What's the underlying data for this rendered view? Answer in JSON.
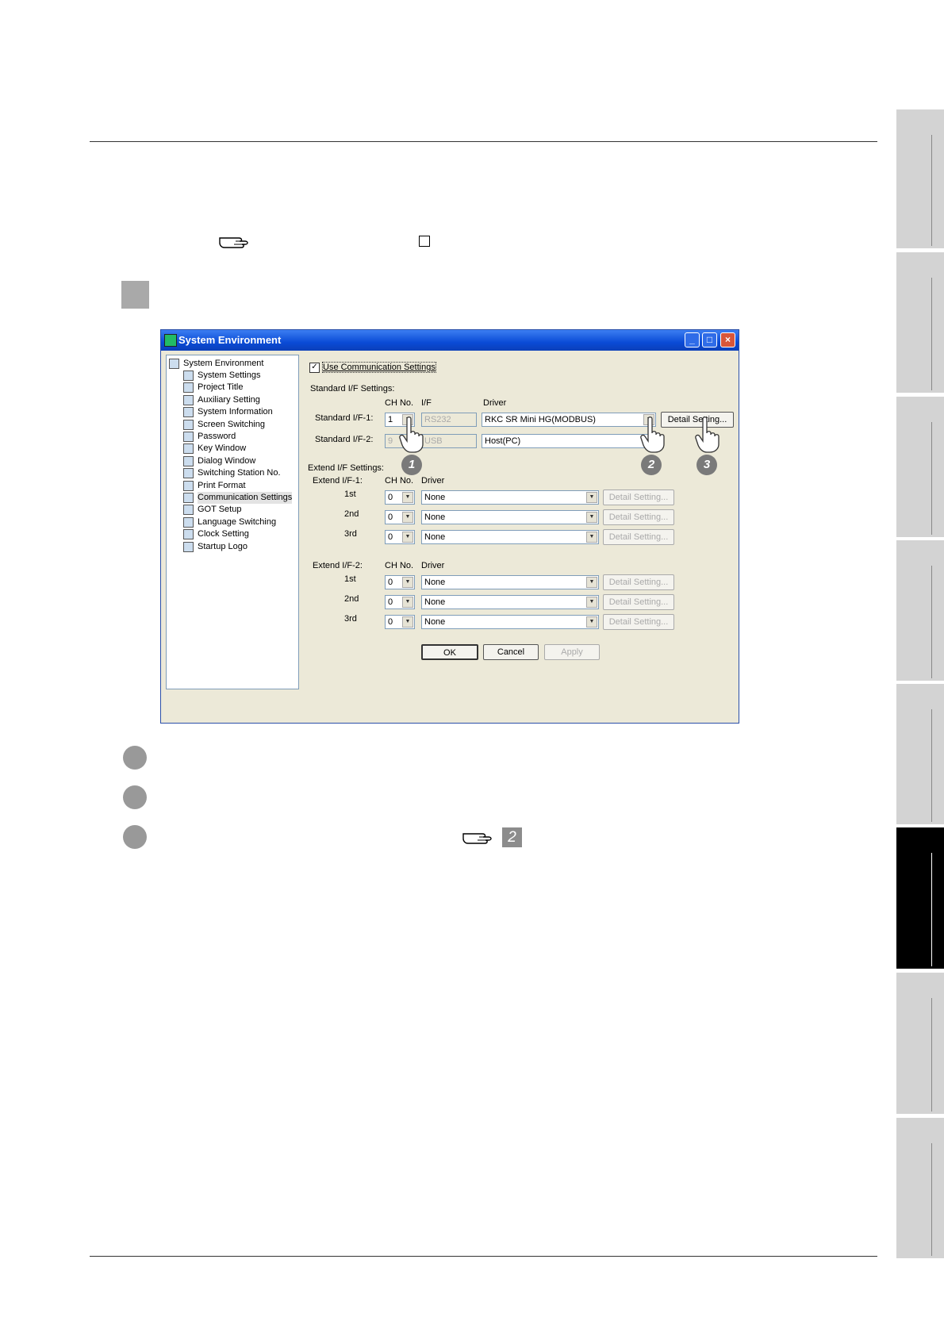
{
  "dialog": {
    "title": "System Environment",
    "title_buttons": {
      "minimize": "_",
      "maximize": "□",
      "close": "×"
    },
    "tree": [
      {
        "label": "System Environment",
        "icon": "settings-icon"
      },
      {
        "label": "System Settings",
        "icon": "system-icon"
      },
      {
        "label": "Project Title",
        "icon": "title-icon"
      },
      {
        "label": "Auxiliary Setting",
        "icon": "plus-icon"
      },
      {
        "label": "System Information",
        "icon": "info-icon"
      },
      {
        "label": "Screen Switching",
        "icon": "screen-icon"
      },
      {
        "label": "Password",
        "icon": "lock-icon"
      },
      {
        "label": "Key Window",
        "icon": "keyboard-icon"
      },
      {
        "label": "Dialog Window",
        "icon": "warning-icon"
      },
      {
        "label": "Switching Station No.",
        "icon": "station-icon"
      },
      {
        "label": "Print Format",
        "icon": "grid-icon"
      },
      {
        "label": "Communication Settings",
        "icon": "plug-icon"
      },
      {
        "label": "GOT Setup",
        "icon": "got-icon"
      },
      {
        "label": "Language Switching",
        "icon": "language-icon"
      },
      {
        "label": "Clock Setting",
        "icon": "clock-icon"
      },
      {
        "label": "Startup Logo",
        "icon": "logo-icon"
      }
    ],
    "use_comm": "Use Communication Settings",
    "standard_title": "Standard I/F Settings:",
    "headers": {
      "ch": "CH No.",
      "if": "I/F",
      "driver": "Driver"
    },
    "std1": {
      "label": "Standard I/F-1:",
      "ch": "1",
      "if": "RS232",
      "driver": "RKC SR Mini HG(MODBUS)",
      "detail": "Detail Setting..."
    },
    "std2": {
      "label": "Standard I/F-2:",
      "ch": "9",
      "if": "USB",
      "driver": "Host(PC)"
    },
    "extend_title": "Extend I/F Settings:",
    "ext1": {
      "label": "Extend I/F-1:",
      "ch_header": "CH No.",
      "driver_header": "Driver",
      "rows": [
        {
          "name": "1st",
          "ch": "0",
          "driver": "None",
          "detail": "Detail Setting..."
        },
        {
          "name": "2nd",
          "ch": "0",
          "driver": "None",
          "detail": "Detail Setting..."
        },
        {
          "name": "3rd",
          "ch": "0",
          "driver": "None",
          "detail": "Detail Setting..."
        }
      ]
    },
    "ext2": {
      "label": "Extend I/F-2:",
      "ch_header": "CH No.",
      "driver_header": "Driver",
      "rows": [
        {
          "name": "1st",
          "ch": "0",
          "driver": "None",
          "detail": "Detail Setting..."
        },
        {
          "name": "2nd",
          "ch": "0",
          "driver": "None",
          "detail": "Detail Setting..."
        },
        {
          "name": "3rd",
          "ch": "0",
          "driver": "None",
          "detail": "Detail Setting..."
        }
      ]
    },
    "buttons": {
      "ok": "OK",
      "cancel": "Cancel",
      "apply": "Apply"
    },
    "callouts": [
      "1",
      "2",
      "3"
    ]
  },
  "reference_number": "2"
}
